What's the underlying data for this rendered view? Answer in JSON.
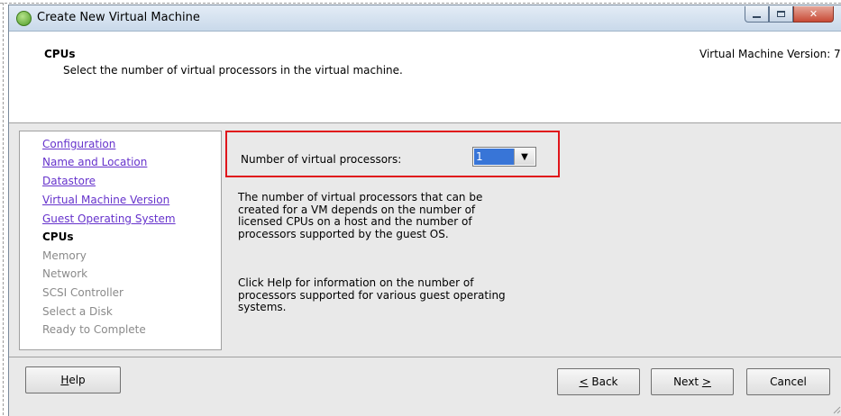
{
  "window": {
    "title": "Create New Virtual Machine"
  },
  "header": {
    "title": "CPUs",
    "subtitle": "Select the number of virtual processors in the virtual machine.",
    "version": "Virtual Machine Version: 7"
  },
  "nav": {
    "items": [
      {
        "label": "Configuration",
        "state": "link"
      },
      {
        "label": "Name and Location",
        "state": "link"
      },
      {
        "label": "Datastore",
        "state": "link"
      },
      {
        "label": "Virtual Machine Version",
        "state": "link"
      },
      {
        "label": "Guest Operating System",
        "state": "link"
      },
      {
        "label": "CPUs",
        "state": "active"
      },
      {
        "label": "Memory",
        "state": "disabled"
      },
      {
        "label": "Network",
        "state": "disabled"
      },
      {
        "label": "SCSI Controller",
        "state": "disabled"
      },
      {
        "label": "Select a Disk",
        "state": "disabled"
      },
      {
        "label": "Ready to Complete",
        "state": "disabled"
      }
    ]
  },
  "main": {
    "cpu_label": "Number of virtual processors:",
    "cpu_value": "1",
    "para1": [
      "The number of virtual processors that can be",
      "created for a VM depends on the number of",
      "licensed CPUs on a host and the number of",
      "processors supported by the guest OS."
    ],
    "para2": [
      "Click Help for information on the number of",
      "processors supported for various guest operating",
      "systems."
    ]
  },
  "buttons": {
    "help": {
      "mnemonic": "H",
      "rest": "elp"
    },
    "back": {
      "mnemonic": "<",
      "rest": " Back"
    },
    "next": {
      "prefix": "Next ",
      "mnemonic": ">"
    },
    "cancel": "Cancel"
  },
  "colors": {
    "link": "#6633cc",
    "highlight_border": "#e0151b",
    "selection": "#3875d7"
  }
}
